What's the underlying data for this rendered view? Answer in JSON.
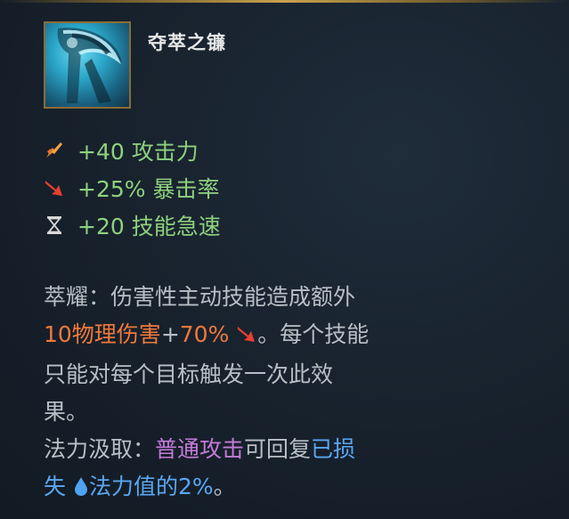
{
  "item": {
    "name": "夺萃之镰",
    "icon": "scythe-item-icon"
  },
  "stats": [
    {
      "icon": "attack-damage-icon",
      "text": "+40 攻击力",
      "color": "#8ed17e"
    },
    {
      "icon": "crit-chance-icon",
      "text": "+25% 暴击率",
      "color": "#8ed17e"
    },
    {
      "icon": "ability-haste-icon",
      "text": "+20 技能急速",
      "color": "#8ed17e"
    }
  ],
  "passive1": {
    "line1": "萃耀：伤害性主动技能造成额外",
    "dmg_text": "10物理伤害",
    "plus_text": "+",
    "ratio_text": "70%",
    "line2_tail": "。每个技能",
    "line3": "只能对每个目标触发一次此效",
    "line4": "果。"
  },
  "passive2": {
    "label": "法力汲取：",
    "on_hit": "普通攻击",
    "middle": "可回复",
    "lost": "已损",
    "lost2": "失",
    "mana": "法力值的2%",
    "end": "。"
  },
  "colors": {
    "stat_green": "#8ed17e",
    "damage_orange": "#f0793b",
    "on_hit_purple": "#c37bd8",
    "mana_blue": "#5aa7f2",
    "body_text": "#b9bfc6"
  }
}
